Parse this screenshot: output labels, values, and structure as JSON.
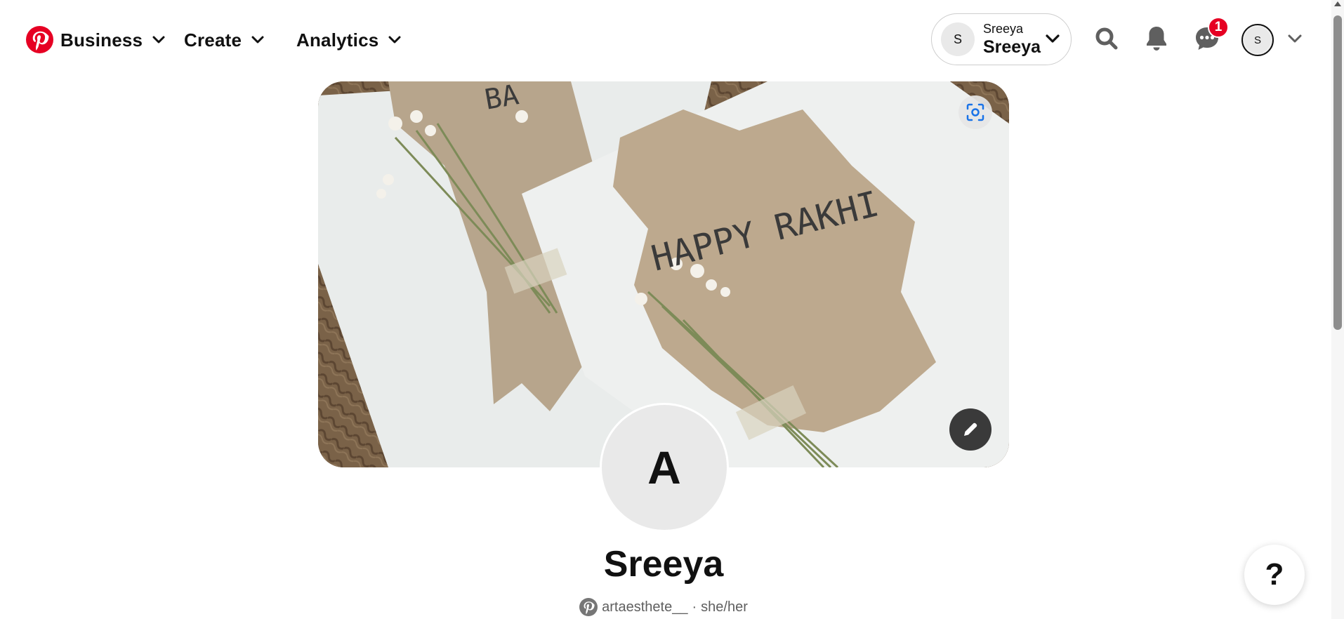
{
  "header": {
    "logo_icon": "pinterest-logo-icon",
    "nav": [
      {
        "label": "Business",
        "icon": "chevron-down-icon"
      },
      {
        "label": "Create",
        "icon": "chevron-down-icon"
      },
      {
        "label": "Analytics",
        "icon": "chevron-down-icon"
      }
    ],
    "account_switcher": {
      "avatar_letter": "S",
      "small_name": "Sreeya",
      "name": "Sreeya",
      "icon": "chevron-down-icon"
    },
    "icons": [
      "search-icon",
      "bell-icon",
      "messages-icon"
    ],
    "messages_badge": "1",
    "profile_avatar_letter": "S"
  },
  "cover": {
    "image_text_top": "BA",
    "image_text_main": "HAPPY RAKHI",
    "lens_icon": "visual-search-icon",
    "edit_icon": "pencil-icon"
  },
  "profile": {
    "avatar_letter": "A",
    "name": "Sreeya",
    "handle": "artaesthete__",
    "separator": "·",
    "pronouns": "she/her"
  },
  "help": {
    "label": "?"
  },
  "colors": {
    "brand": "#e60023",
    "text": "#111111",
    "muted": "#5f5f5f"
  }
}
